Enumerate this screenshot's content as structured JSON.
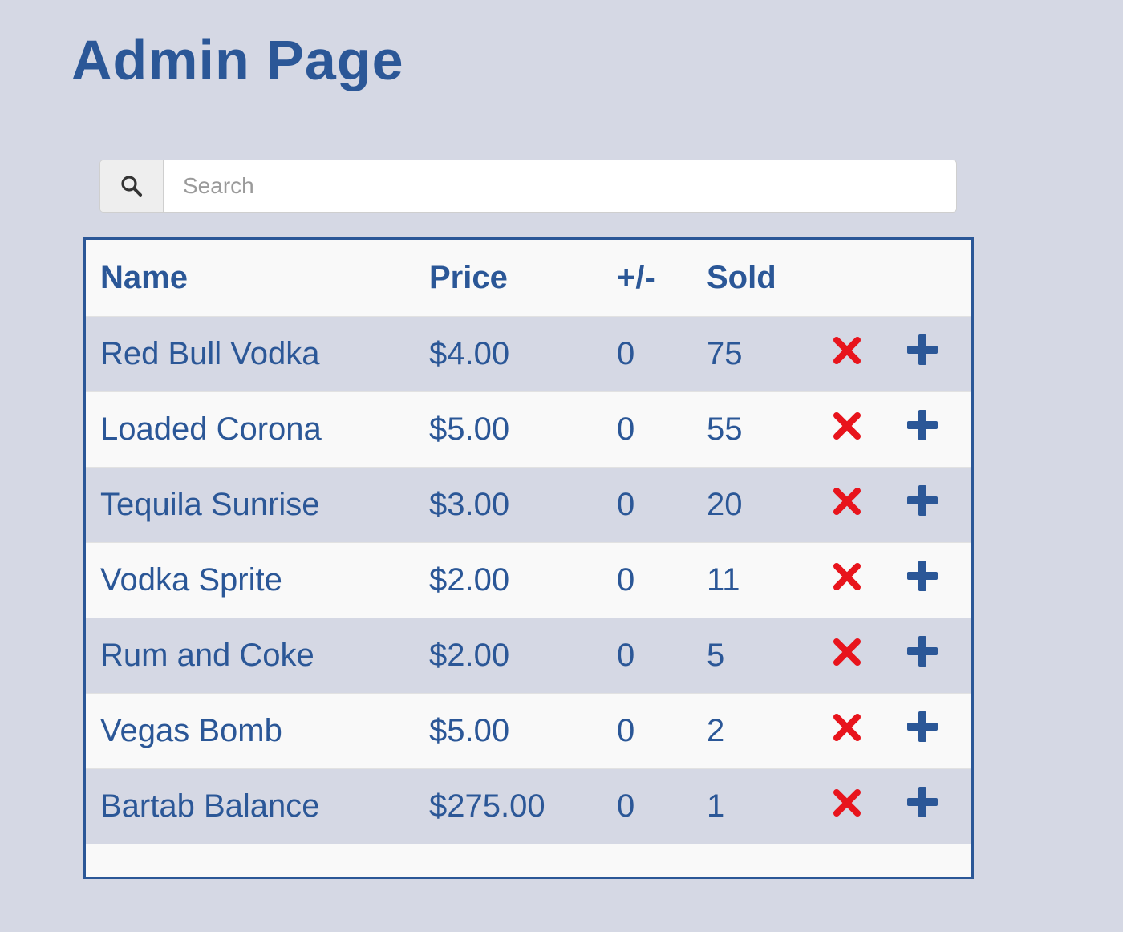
{
  "page": {
    "title": "Admin Page"
  },
  "search": {
    "placeholder": "Search",
    "icon": "search-icon"
  },
  "table": {
    "headers": {
      "name": "Name",
      "price": "Price",
      "delta": "+/-",
      "sold": "Sold"
    },
    "rows": [
      {
        "name": "Red Bull Vodka",
        "price": "$4.00",
        "delta": "0",
        "sold": "75"
      },
      {
        "name": "Loaded Corona",
        "price": "$5.00",
        "delta": "0",
        "sold": "55"
      },
      {
        "name": "Tequila Sunrise",
        "price": "$3.00",
        "delta": "0",
        "sold": "20"
      },
      {
        "name": "Vodka Sprite",
        "price": "$2.00",
        "delta": "0",
        "sold": "11"
      },
      {
        "name": "Rum and Coke",
        "price": "$2.00",
        "delta": "0",
        "sold": "5"
      },
      {
        "name": "Vegas Bomb",
        "price": "$5.00",
        "delta": "0",
        "sold": "2"
      },
      {
        "name": "Bartab Balance",
        "price": "$275.00",
        "delta": "0",
        "sold": "1"
      }
    ],
    "row_actions": {
      "delete_icon": "close-icon",
      "add_icon": "plus-icon"
    }
  },
  "colors": {
    "background": "#d5d8e4",
    "accent": "#2b5797",
    "delete": "#e8141c",
    "row_light": "#f9f9f9"
  }
}
